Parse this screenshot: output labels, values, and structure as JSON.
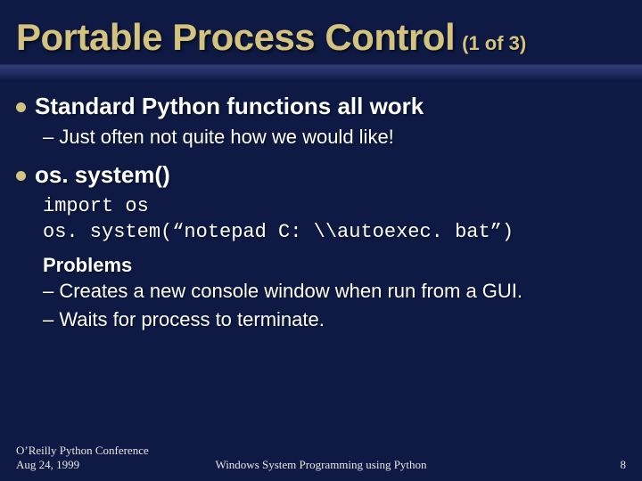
{
  "title": "Portable Process Control",
  "title_count": "(1 of 3)",
  "bullets": [
    {
      "text": "Standard Python functions all work",
      "sub": [
        "– Just often not quite how we would like!"
      ]
    },
    {
      "text": "os. system()",
      "code": [
        "import os",
        "os. system(“notepad C: \\\\autoexec. bat”)"
      ],
      "problems_head": "Problems",
      "problems": [
        "– Creates a new console window when run from a GUI.",
        "– Waits for process to terminate."
      ]
    }
  ],
  "footer": {
    "left_line1": "O’Reilly Python Conference",
    "left_line2": "Aug 24, 1999",
    "center": "Windows System Programming using Python",
    "page": "8"
  }
}
